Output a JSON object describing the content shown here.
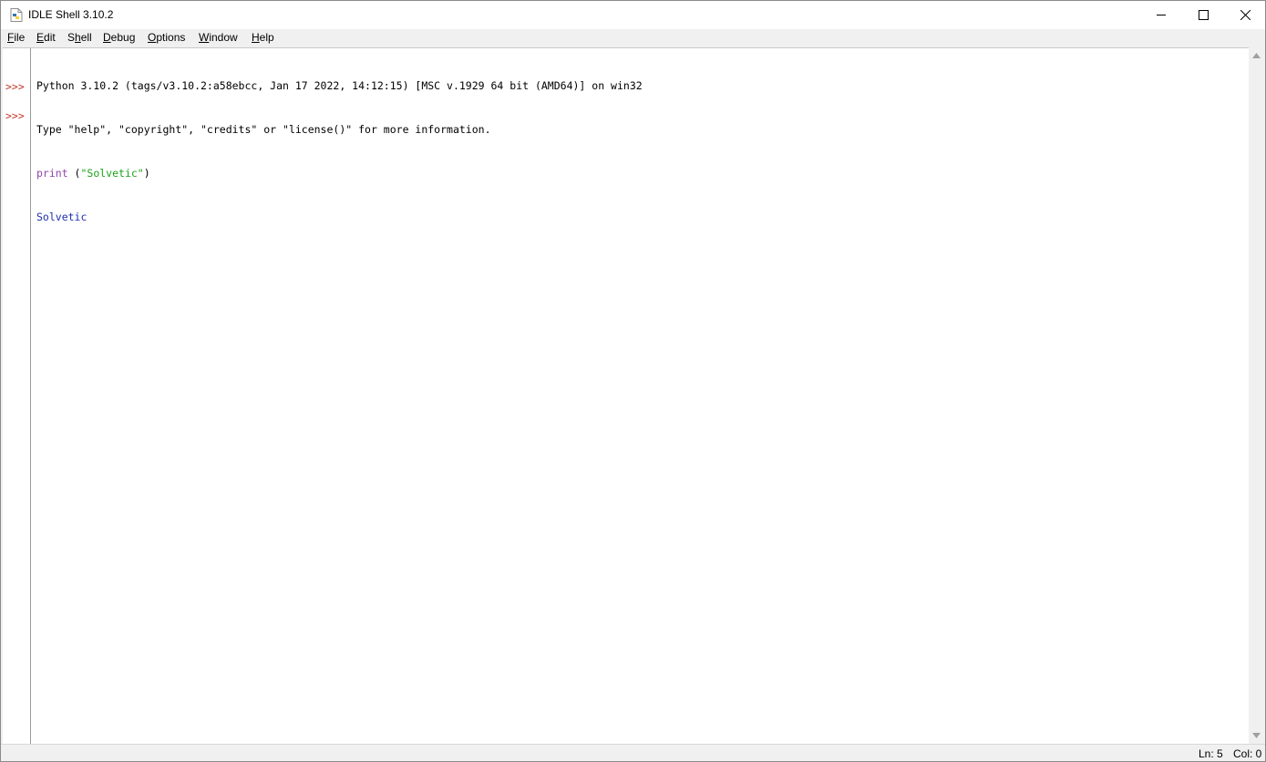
{
  "window": {
    "title": "IDLE Shell 3.10.2"
  },
  "menu": [
    {
      "label": "File",
      "key": "F"
    },
    {
      "label": "Edit",
      "key": "E"
    },
    {
      "label": "Shell",
      "key": "h"
    },
    {
      "label": "Debug",
      "key": "D"
    },
    {
      "label": "Options",
      "key": "O"
    },
    {
      "label": "Window",
      "key": "W"
    },
    {
      "label": "Help",
      "key": "H"
    }
  ],
  "shell": {
    "banner_line1": "Python 3.10.2 (tags/v3.10.2:a58ebcc, Jan 17 2022, 14:12:15) [MSC v.1929 64 bit (AMD64)] on win32",
    "banner_line2": "Type \"help\", \"copyright\", \"credits\" or \"license()\" for more information.",
    "prompt": ">>>",
    "input_keyword": "print",
    "input_open": " (",
    "input_string": "\"Solvetic\"",
    "input_close": ")",
    "output": "Solvetic"
  },
  "status": {
    "line": "Ln: 5",
    "col": "Col: 0"
  },
  "colors": {
    "prompt": "#c0392b",
    "keyword": "#8e44ad",
    "string": "#1aa31a",
    "output": "#1f2fb0"
  },
  "icons": [
    "python-file-icon",
    "minimize-icon",
    "maximize-icon",
    "close-icon",
    "scroll-up-arrow-icon",
    "scroll-down-arrow-icon"
  ]
}
